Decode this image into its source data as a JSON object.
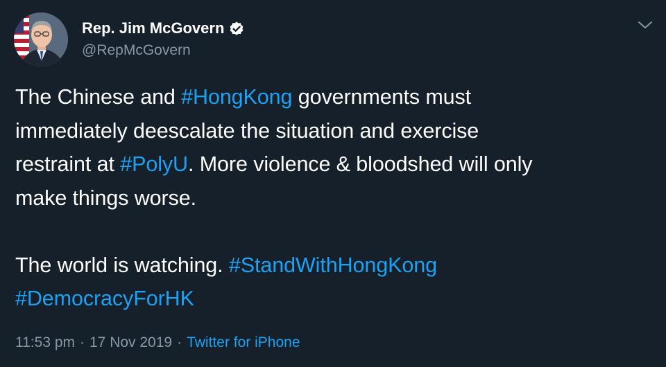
{
  "author": {
    "display_name": "Rep. Jim McGovern",
    "handle": "@RepMcGovern",
    "verified": true,
    "avatar_icon": "profile-photo"
  },
  "tweet": {
    "lines": [
      [
        {
          "text": "The Chinese and ",
          "hashtag": false
        },
        {
          "text": "#HongKong",
          "hashtag": true
        },
        {
          "text": " governments must",
          "hashtag": false
        }
      ],
      [
        {
          "text": "immediately deescalate the situation and exercise",
          "hashtag": false
        }
      ],
      [
        {
          "text": "restraint at ",
          "hashtag": false
        },
        {
          "text": "#PolyU",
          "hashtag": true
        },
        {
          "text": ". More violence & bloodshed will only",
          "hashtag": false
        }
      ],
      [
        {
          "text": "make things worse.",
          "hashtag": false
        }
      ],
      [],
      [
        {
          "text": "The world is watching. ",
          "hashtag": false
        },
        {
          "text": "#StandWithHongKong",
          "hashtag": true
        }
      ],
      [
        {
          "text": "#DemocracyForHK",
          "hashtag": true
        }
      ]
    ]
  },
  "meta": {
    "time": "11:53 pm",
    "separator": "·",
    "date": "17 Nov 2019",
    "source": "Twitter for iPhone"
  },
  "colors": {
    "background": "#15202b",
    "text": "#ffffff",
    "secondary_text": "#8899a6",
    "link": "#1da1f2"
  },
  "icons": {
    "verified": "verified-badge-icon",
    "menu": "chevron-down-icon"
  }
}
